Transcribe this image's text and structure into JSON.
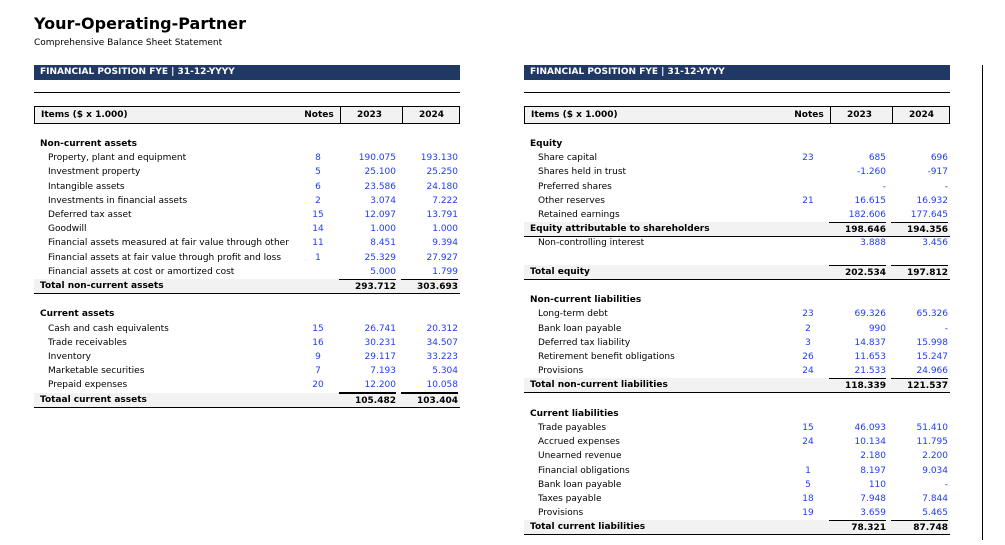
{
  "doc": {
    "title": "Your-Operating-Partner",
    "subtitle": "Comprehensive Balance Sheet Statement"
  },
  "left": {
    "banner": "FINANCIAL POSITION FYE | 31-12-YYYY",
    "header": {
      "label": "Items ($ x 1.000)",
      "notes": "Notes",
      "y1": "2023",
      "y2": "2024"
    },
    "rows": [
      {
        "label": "Non-current assets",
        "type": "section"
      },
      {
        "label": "Property, plant and equipment",
        "notes": "8",
        "v1": "190.075",
        "v2": "193.130",
        "type": "item"
      },
      {
        "label": "Investment property",
        "notes": "5",
        "v1": "25.100",
        "v2": "25.250",
        "type": "item"
      },
      {
        "label": "Intangible assets",
        "notes": "6",
        "v1": "23.586",
        "v2": "24.180",
        "type": "item"
      },
      {
        "label": "Investments in financial assets",
        "notes": "2",
        "v1": "3.074",
        "v2": "7.222",
        "type": "item"
      },
      {
        "label": "Deferred tax asset",
        "notes": "15",
        "v1": "12.097",
        "v2": "13.791",
        "type": "item"
      },
      {
        "label": "Goodwill",
        "notes": "14",
        "v1": "1.000",
        "v2": "1.000",
        "type": "item"
      },
      {
        "label": "Financial assets measured at fair value through other",
        "notes": "11",
        "v1": "8.451",
        "v2": "9.394",
        "type": "item"
      },
      {
        "label": "Financial assets at fair value through profit and loss",
        "notes": "1",
        "v1": "25.329",
        "v2": "27.927",
        "type": "item"
      },
      {
        "label": "Financial assets at cost or amortized cost",
        "notes": "",
        "v1": "5.000",
        "v2": "1.799",
        "type": "item-ul"
      },
      {
        "label": "Total non-current assets",
        "notes": "",
        "v1": "293.712",
        "v2": "303.693",
        "type": "total"
      },
      {
        "label": "",
        "type": "blank"
      },
      {
        "label": "Current assets",
        "type": "section"
      },
      {
        "label": "Cash and cash equivalents",
        "notes": "15",
        "v1": "26.741",
        "v2": "20.312",
        "type": "item"
      },
      {
        "label": "Trade receivables",
        "notes": "16",
        "v1": "30.231",
        "v2": "34.507",
        "type": "item"
      },
      {
        "label": "Inventory",
        "notes": "9",
        "v1": "29.117",
        "v2": "33.223",
        "type": "item"
      },
      {
        "label": "Marketable securities",
        "notes": "7",
        "v1": "7.193",
        "v2": "5.304",
        "type": "item"
      },
      {
        "label": "Prepaid expenses",
        "notes": "20",
        "v1": "12.200",
        "v2": "10.058",
        "type": "item-ul"
      },
      {
        "label": "Totaal current assets",
        "notes": "",
        "v1": "105.482",
        "v2": "103.404",
        "type": "total"
      }
    ]
  },
  "right": {
    "banner": "FINANCIAL POSITION FYE | 31-12-YYYY",
    "header": {
      "label": "Items ($ x 1.000)",
      "notes": "Notes",
      "y1": "2023",
      "y2": "2024"
    },
    "rows": [
      {
        "label": "Equity",
        "type": "section"
      },
      {
        "label": "Share capital",
        "notes": "23",
        "v1": "685",
        "v2": "696",
        "type": "item"
      },
      {
        "label": "Shares held in trust",
        "notes": "",
        "v1": "-1.260",
        "v2": "-917",
        "type": "item"
      },
      {
        "label": "Preferred shares",
        "notes": "",
        "v1": "-",
        "v2": "-",
        "type": "item"
      },
      {
        "label": "Other reserves",
        "notes": "21",
        "v1": "16.615",
        "v2": "16.932",
        "type": "item"
      },
      {
        "label": "Retained earnings",
        "notes": "",
        "v1": "182.606",
        "v2": "177.645",
        "type": "item-ul"
      },
      {
        "label": "Equity attributable to shareholders",
        "notes": "",
        "v1": "198.646",
        "v2": "194.356",
        "type": "total"
      },
      {
        "label": "Non-controlling interest",
        "notes": "",
        "v1": "3.888",
        "v2": "3.456",
        "type": "item"
      },
      {
        "label": "",
        "type": "blank"
      },
      {
        "label": "Total equity",
        "notes": "",
        "v1": "202.534",
        "v2": "197.812",
        "type": "total"
      },
      {
        "label": "",
        "type": "blank"
      },
      {
        "label": "Non-current liabilities",
        "type": "section"
      },
      {
        "label": "Long-term debt",
        "notes": "23",
        "v1": "69.326",
        "v2": "65.326",
        "type": "item"
      },
      {
        "label": "Bank loan payable",
        "notes": "2",
        "v1": "990",
        "v2": "-",
        "type": "item"
      },
      {
        "label": "Deferred tax liability",
        "notes": "3",
        "v1": "14.837",
        "v2": "15.998",
        "type": "item"
      },
      {
        "label": "Retirement benefit obligations",
        "notes": "26",
        "v1": "11.653",
        "v2": "15.247",
        "type": "item"
      },
      {
        "label": "Provisions",
        "notes": "24",
        "v1": "21.533",
        "v2": "24.966",
        "type": "item-ul"
      },
      {
        "label": "Total non-current liabilities",
        "notes": "",
        "v1": "118.339",
        "v2": "121.537",
        "type": "total"
      },
      {
        "label": "",
        "type": "blank"
      },
      {
        "label": "Current liabilities",
        "type": "section"
      },
      {
        "label": "Trade payables",
        "notes": "15",
        "v1": "46.093",
        "v2": "51.410",
        "type": "item"
      },
      {
        "label": "Accrued expenses",
        "notes": "24",
        "v1": "10.134",
        "v2": "11.795",
        "type": "item"
      },
      {
        "label": "Unearned revenue",
        "notes": "",
        "v1": "2.180",
        "v2": "2.200",
        "type": "item"
      },
      {
        "label": "Financial obligations",
        "notes": "1",
        "v1": "8.197",
        "v2": "9.034",
        "type": "item"
      },
      {
        "label": "Bank loan payable",
        "notes": "5",
        "v1": "110",
        "v2": "-",
        "type": "item"
      },
      {
        "label": "Taxes payable",
        "notes": "18",
        "v1": "7.948",
        "v2": "7.844",
        "type": "item"
      },
      {
        "label": "Provisions",
        "notes": "19",
        "v1": "3.659",
        "v2": "5.465",
        "type": "item-ul"
      },
      {
        "label": "Total current liabilities",
        "notes": "",
        "v1": "78.321",
        "v2": "87.748",
        "type": "total"
      }
    ]
  }
}
